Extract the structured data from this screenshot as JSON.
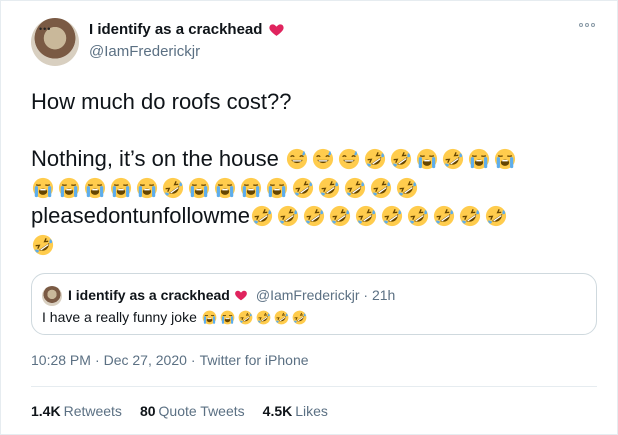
{
  "user": {
    "display_name": "I identify as a crackhead",
    "handle": "@IamFrederickjr"
  },
  "tweet": {
    "line1": "How much do roofs cost??",
    "line2_text": "Nothing,  it’s on the house ",
    "line2_emojis": [
      "sweat-smile",
      "sweat-smile",
      "sweat-smile",
      "rofl",
      "rofl",
      "loud-cry",
      "rofl",
      "loud-cry",
      "loud-cry"
    ],
    "line3_emojis": [
      "loud-cry",
      "loud-cry",
      "loud-cry",
      "loud-cry",
      "loud-cry",
      "rofl",
      "loud-cry",
      "loud-cry",
      "loud-cry",
      "loud-cry",
      "rofl",
      "rofl",
      "rofl",
      "rofl",
      "rofl"
    ],
    "line4_text": "pleasedontunfollowme",
    "line4_emojis": [
      "rofl",
      "rofl",
      "rofl",
      "rofl",
      "rofl",
      "rofl",
      "rofl",
      "rofl",
      "rofl",
      "rofl"
    ],
    "line5_emojis": [
      "rofl"
    ]
  },
  "quote": {
    "display_name": "I identify as a crackhead",
    "handle_time": "@IamFrederickjr · 21h",
    "text": "I have a really funny joke ",
    "emojis": [
      "loud-cry",
      "loud-cry",
      "rofl",
      "rofl",
      "rofl",
      "rofl"
    ]
  },
  "meta": {
    "time": "10:28 PM",
    "sep1": "·",
    "date": "Dec 27, 2020",
    "sep2": "·",
    "source": "Twitter for iPhone"
  },
  "stats": {
    "retweets_count": "1.4K",
    "retweets_label": "Retweets",
    "quotes_count": "80",
    "quotes_label": "Quote Tweets",
    "likes_count": "4.5K",
    "likes_label": "Likes"
  },
  "colors": {
    "heart": "#e0245e",
    "muted": "#5b7083",
    "text": "#0f1419"
  }
}
